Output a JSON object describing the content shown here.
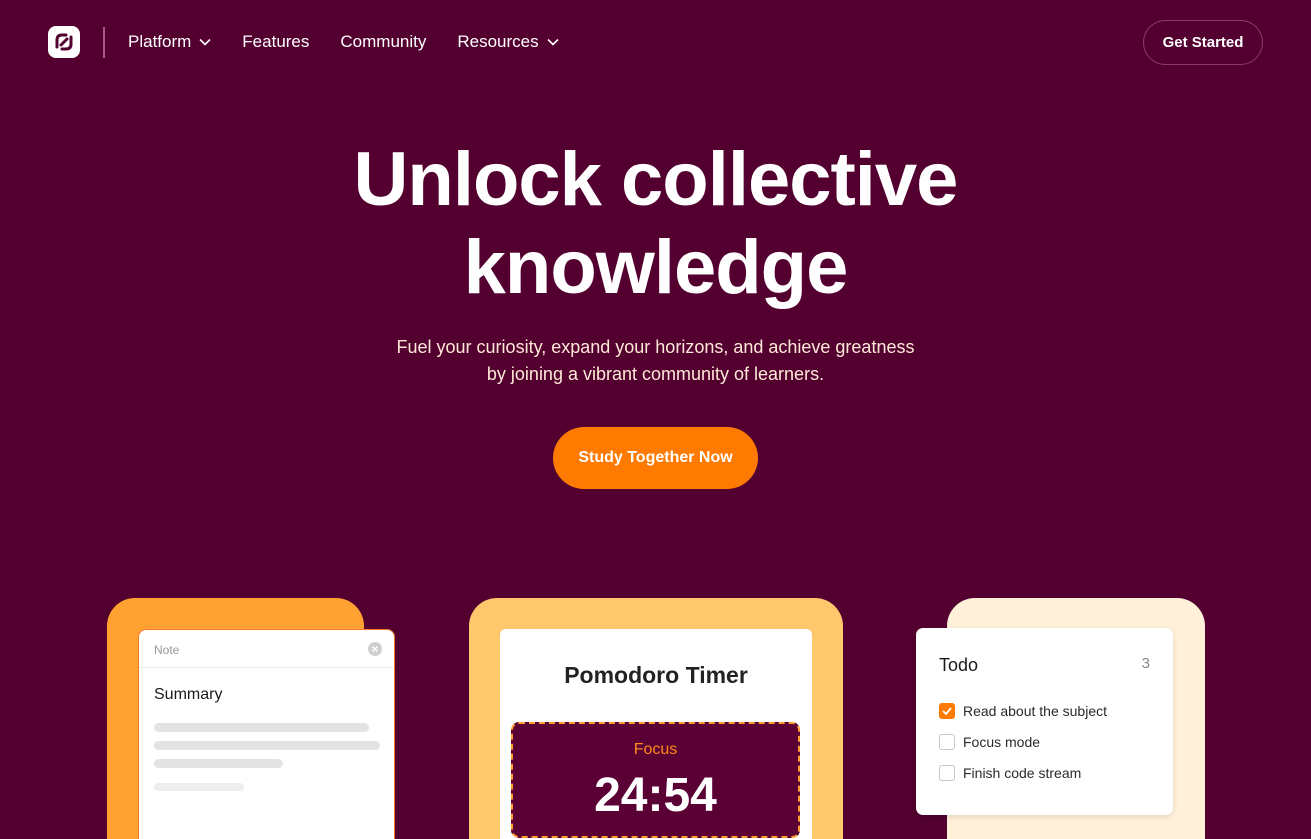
{
  "nav": {
    "logo_icon": "chain-link-logo",
    "items": [
      {
        "label": "Platform",
        "has_dropdown": true
      },
      {
        "label": "Features",
        "has_dropdown": false
      },
      {
        "label": "Community",
        "has_dropdown": false
      },
      {
        "label": "Resources",
        "has_dropdown": true
      }
    ],
    "cta_label": "Get Started"
  },
  "hero": {
    "title_line1": "Unlock collective",
    "title_line2": "knowledge",
    "subtitle_line1": "Fuel your curiosity, expand your horizons, and achieve greatness",
    "subtitle_line2": "by joining a vibrant community of learners.",
    "cta_label": "Study Together Now"
  },
  "note_card": {
    "header": "Note",
    "title": "Summary"
  },
  "pomodoro_card": {
    "title": "Pomodoro Timer",
    "mode": "Focus",
    "time": "24:54"
  },
  "todo_card": {
    "title": "Todo",
    "count": "3",
    "items": [
      {
        "label": "Read about the subject",
        "checked": true
      },
      {
        "label": "Focus mode",
        "checked": false
      },
      {
        "label": "Finish code stream",
        "checked": false
      }
    ]
  },
  "colors": {
    "background": "#530030",
    "accent": "#ff7a00",
    "card1": "#ffa232",
    "card2": "#ffc86c",
    "card3": "#fff1d9"
  }
}
